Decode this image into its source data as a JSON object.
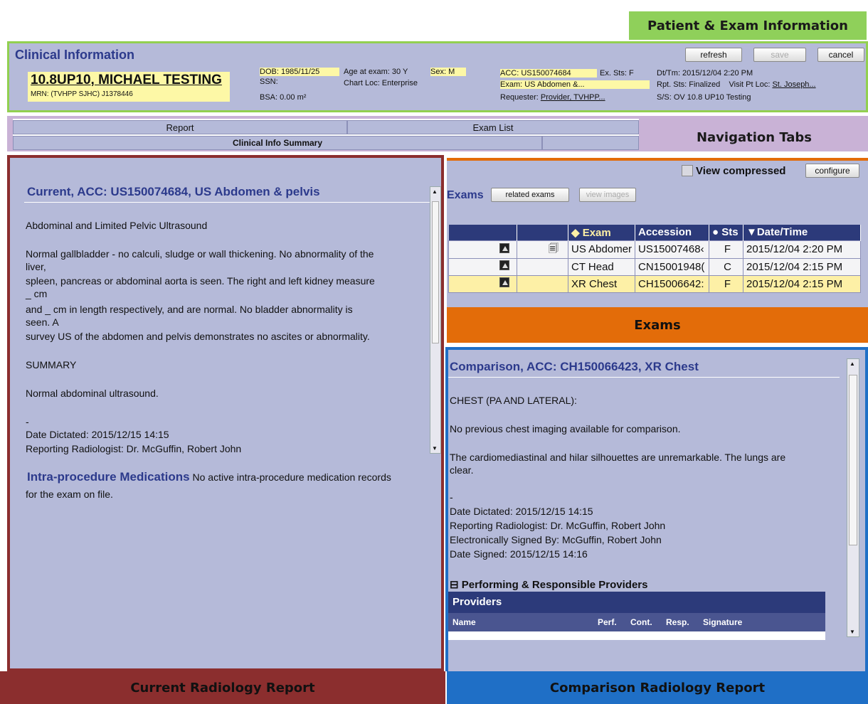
{
  "tags": {
    "patient": "Patient & Exam Information",
    "nav": "Navigation Tabs",
    "current": "Current Radiology Report",
    "exams": "Exams",
    "comparison": "Comparison Radiology Report"
  },
  "header": {
    "title": "Clinical Information",
    "refresh": "refresh",
    "save": "save",
    "cancel": "cancel",
    "patient_name": "10.8UP10, MICHAEL TESTING",
    "mrn": "MRN: (TVHPP SJHC) J1378446",
    "dob": "DOB:  1985/11/25",
    "ssn": "SSN:",
    "bsa": "BSA:  0.00 m²",
    "age": "Age at exam:  30 Y",
    "sex": "Sex:  M",
    "chart_loc": "Chart Loc:  Enterprise",
    "acc": "ACC:  US150074684",
    "ex_sts": "Ex. Sts:  F",
    "exam": "Exam:  US Abdomen &...",
    "requester_label": "Requester:",
    "requester": "Provider, TVHPP...",
    "dttm": "Dt/Tm:  2015/12/04 2:20 PM",
    "rpt_sts": "Rpt. Sts:  Finalized",
    "visit_label": "Visit Pt Loc:",
    "visit": "St. Joseph...",
    "ss": "S/S:  OV 10.8 UP10 Testing"
  },
  "nav": {
    "report": "Report",
    "exam_list": "Exam List",
    "clinical_summary": "Clinical Info Summary"
  },
  "current": {
    "title": "Current, ACC: US150074684, US Abdomen & pelvis",
    "lines": [
      "Abdominal and Limited Pelvic Ultrasound",
      "Normal gallbladder - no calculi, sludge or wall thickening. No abnormality of the",
      "liver,",
      "spleen, pancreas or abdominal aorta is seen. The right and left kidney measure",
      "_ cm",
      "and _ cm in length respectively, and are normal. No bladder abnormality is",
      "seen. A",
      "survey US of the abdomen and pelvis demonstrates no ascites or abnormality.",
      "SUMMARY",
      "Normal abdominal ultrasound.",
      "-",
      "Date Dictated: 2015/12/15 14:15",
      "Reporting Radiologist: Dr. McGuffin, Robert John"
    ],
    "meds_title": "Intra-procedure Medications",
    "meds_text": "No active intra-procedure medication records",
    "meds_text2": "for the exam on file."
  },
  "exams": {
    "view_compressed": "View compressed",
    "configure": "configure",
    "label": "Exams",
    "related": "related exams",
    "view_images": "view images",
    "columns": [
      "◆ Exam",
      "Accession",
      "● Sts",
      "▼Date/Time"
    ],
    "rows": [
      {
        "exam": "US Abdomer",
        "acc": "US15007468‹",
        "sts": "F",
        "dt": "2015/12/04 2:20 PM"
      },
      {
        "exam": "CT Head",
        "acc": "CN15001948(",
        "sts": "C",
        "dt": "2015/12/04 2:15 PM"
      },
      {
        "exam": "XR Chest",
        "acc": "CH15006642:",
        "sts": "F",
        "dt": "2015/12/04 2:15 PM"
      }
    ]
  },
  "comparison": {
    "title": "Comparison, ACC: CH150066423, XR Chest",
    "lines": [
      "CHEST (PA AND LATERAL):",
      "No previous chest imaging available for comparison.",
      "The cardiomediastinal and hilar silhouettes are unremarkable. The lungs are",
      "clear.",
      "-",
      "Date Dictated: 2015/12/15 14:15",
      "Reporting Radiologist: Dr. McGuffin, Robert John",
      "Electronically Signed By: McGuffin, Robert John",
      "Date Signed: 2015/12/15 14:16"
    ],
    "providers_section": "⊟ Performing & Responsible Providers",
    "providers_header": "Providers",
    "prov_cols": [
      "Name",
      "Perf.",
      "Cont.",
      "Resp.",
      "Signature"
    ]
  }
}
